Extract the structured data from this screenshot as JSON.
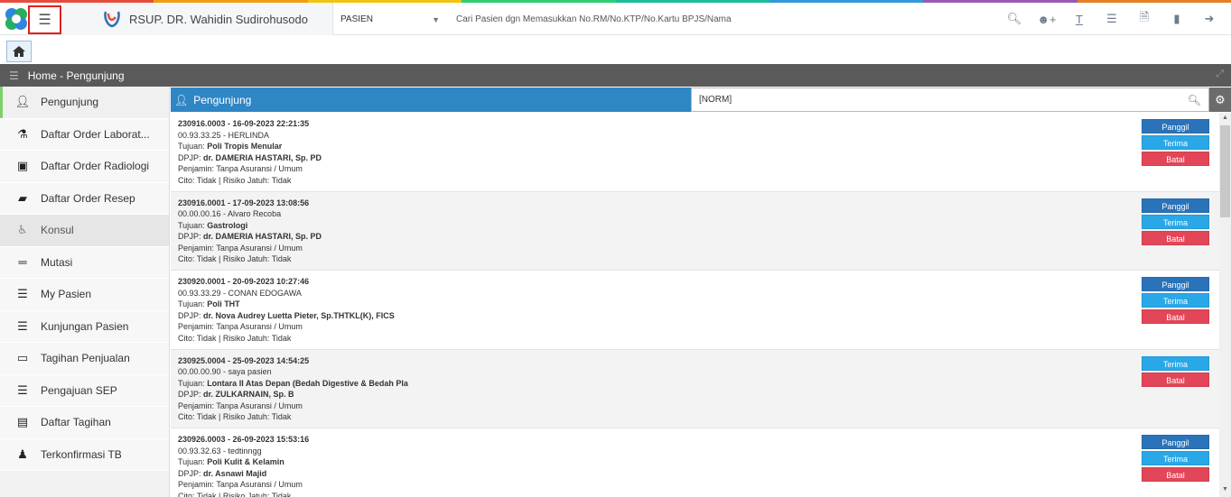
{
  "colors": {
    "stripe": [
      "#e74c3c",
      "#f39c12",
      "#f1c40f",
      "#2ecc71",
      "#1abc9c",
      "#3498db",
      "#9b59b6",
      "#e67e22"
    ],
    "panel_header": "#2f86c4",
    "panggil": "#2a73b8",
    "terima": "#2aa7e6",
    "batal": "#e24658",
    "active_indicator": "#7ed06a"
  },
  "header": {
    "brand": "RSUP. DR. Wahidin Sudirohusodo",
    "module": "PASIEN",
    "search_placeholder": "Cari Pasien dgn Memasukkan No.RM/No.KTP/No.Kartu BPJS/Nama",
    "icons": [
      "search-icon",
      "add-user-icon",
      "text-icon",
      "list-icon",
      "pdf-icon",
      "folder-icon",
      "logout-icon"
    ]
  },
  "breadcrumb": "Home - Pengunjung",
  "sidebar": {
    "items": [
      {
        "label": "Pengunjung",
        "icon": "user-icon"
      },
      {
        "label": "Daftar Order Laborat...",
        "icon": "flask-icon"
      },
      {
        "label": "Daftar Order Radiologi",
        "icon": "xray-icon"
      },
      {
        "label": "Daftar Order Resep",
        "icon": "eraser-icon"
      },
      {
        "label": "Konsul",
        "icon": "wheelchair-icon"
      },
      {
        "label": "Mutasi",
        "icon": "bed-icon"
      },
      {
        "label": "My Pasien",
        "icon": "list-icon"
      },
      {
        "label": "Kunjungan Pasien",
        "icon": "list-icon"
      },
      {
        "label": "Tagihan Penjualan",
        "icon": "credit-card-icon"
      },
      {
        "label": "Pengajuan SEP",
        "icon": "list-icon"
      },
      {
        "label": "Daftar Tagihan",
        "icon": "money-icon"
      },
      {
        "label": "Terkonfirmasi TB",
        "icon": "user-secret-icon"
      }
    ]
  },
  "panel": {
    "title": "Pengunjung",
    "filter_value": "[NORM]"
  },
  "visits": [
    {
      "id_line": "230916.0003 - 16-09-2023 22:21:35",
      "patient": "00.93.33.25 - HERLINDA",
      "tujuan_label": "Tujuan: ",
      "tujuan": "Poli Tropis Menular",
      "dpjp_label": "DPJP: ",
      "dpjp": "dr. DAMERIA HASTARI, Sp. PD",
      "penjamin": "Penjamin: Tanpa Asuransi / Umum",
      "cito": "Cito: Tidak | Risiko Jatuh: Tidak",
      "buttons": [
        "Panggil",
        "Terima",
        "Batal"
      ]
    },
    {
      "id_line": "230916.0001 - 17-09-2023 13:08:56",
      "patient": "00.00.00.16 - Alvaro Recoba",
      "tujuan_label": "Tujuan: ",
      "tujuan": "Gastrologi",
      "dpjp_label": "DPJP: ",
      "dpjp": "dr. DAMERIA HASTARI, Sp. PD",
      "penjamin": "Penjamin: Tanpa Asuransi / Umum",
      "cito": "Cito: Tidak | Risiko Jatuh: Tidak",
      "buttons": [
        "Panggil",
        "Terima",
        "Batal"
      ]
    },
    {
      "id_line": "230920.0001 - 20-09-2023 10:27:46",
      "patient": "00.93.33.29 - CONAN EDOGAWA",
      "tujuan_label": "Tujuan: ",
      "tujuan": "Poli THT",
      "dpjp_label": "DPJP: ",
      "dpjp": "dr. Nova Audrey Luetta Pieter, Sp.THTKL(K), FICS",
      "penjamin": "Penjamin: Tanpa Asuransi / Umum",
      "cito": "Cito: Tidak | Risiko Jatuh: Tidak",
      "buttons": [
        "Panggil",
        "Terima",
        "Batal"
      ]
    },
    {
      "id_line": "230925.0004 - 25-09-2023 14:54:25",
      "patient": "00.00.00.90 - saya pasien",
      "tujuan_label": "Tujuan: ",
      "tujuan": "Lontara II Atas Depan (Bedah Digestive & Bedah Pla",
      "dpjp_label": "DPJP: ",
      "dpjp": "dr. ZULKARNAIN, Sp. B",
      "penjamin": "Penjamin: Tanpa Asuransi / Umum",
      "cito": "Cito: Tidak | Risiko Jatuh: Tidak",
      "buttons": [
        "Terima",
        "Batal"
      ]
    },
    {
      "id_line": "230926.0003 - 26-09-2023 15:53:16",
      "patient": "00.93.32.63 - tedtinngg",
      "tujuan_label": "Tujuan: ",
      "tujuan": "Poli Kulit & Kelamin",
      "dpjp_label": "DPJP: ",
      "dpjp": "dr. Asnawi Majid",
      "penjamin": "Penjamin: Tanpa Asuransi / Umum",
      "cito": "Cito: Tidak | Risiko Jatuh: Tidak",
      "buttons": [
        "Panggil",
        "Terima",
        "Batal"
      ]
    }
  ]
}
